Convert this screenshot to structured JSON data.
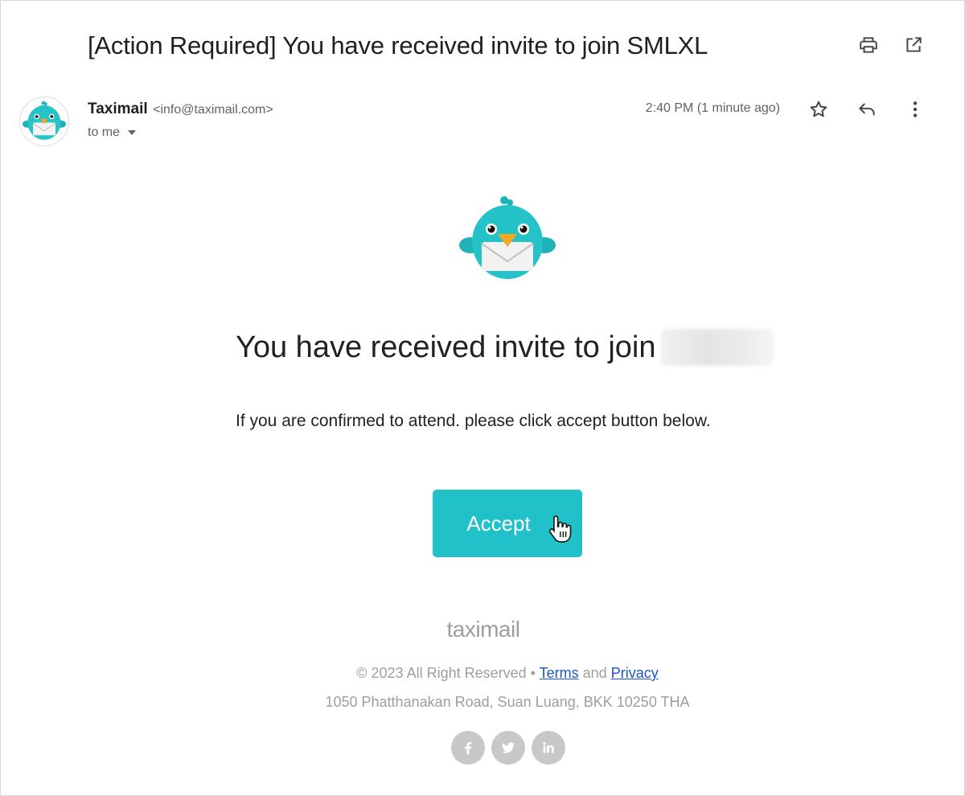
{
  "email": {
    "subject": "[Action Required] You have received invite to join SMLXL",
    "sender_name": "Taximail",
    "sender_email": "<info@taximail.com>",
    "recipient": "to me",
    "timestamp": "2:40 PM (1 minute ago)"
  },
  "toolbar": {
    "print_icon": "print-icon",
    "open_new_window_icon": "open-in-new-icon",
    "star_icon": "star-icon",
    "reply_icon": "reply-icon",
    "more_icon": "more-vert-icon"
  },
  "body": {
    "headline": "You have received invite to join",
    "instructions": "If you are confirmed to attend. please click accept button below.",
    "accept_label": "Accept"
  },
  "footer": {
    "brand": "taximail",
    "copyright_prefix": "© 2023 All Right Reserved •",
    "terms_label": "Terms",
    "and_text": "and",
    "privacy_label": "Privacy",
    "address": "1050 Phatthanakan Road, Suan Luang, BKK 10250 THA",
    "socials": [
      "facebook-icon",
      "twitter-icon",
      "linkedin-icon"
    ]
  },
  "colors": {
    "accent": "#20c1c9",
    "link": "#1a55c8",
    "muted": "#9e9e9e",
    "social_bg": "#c8c8c8"
  }
}
